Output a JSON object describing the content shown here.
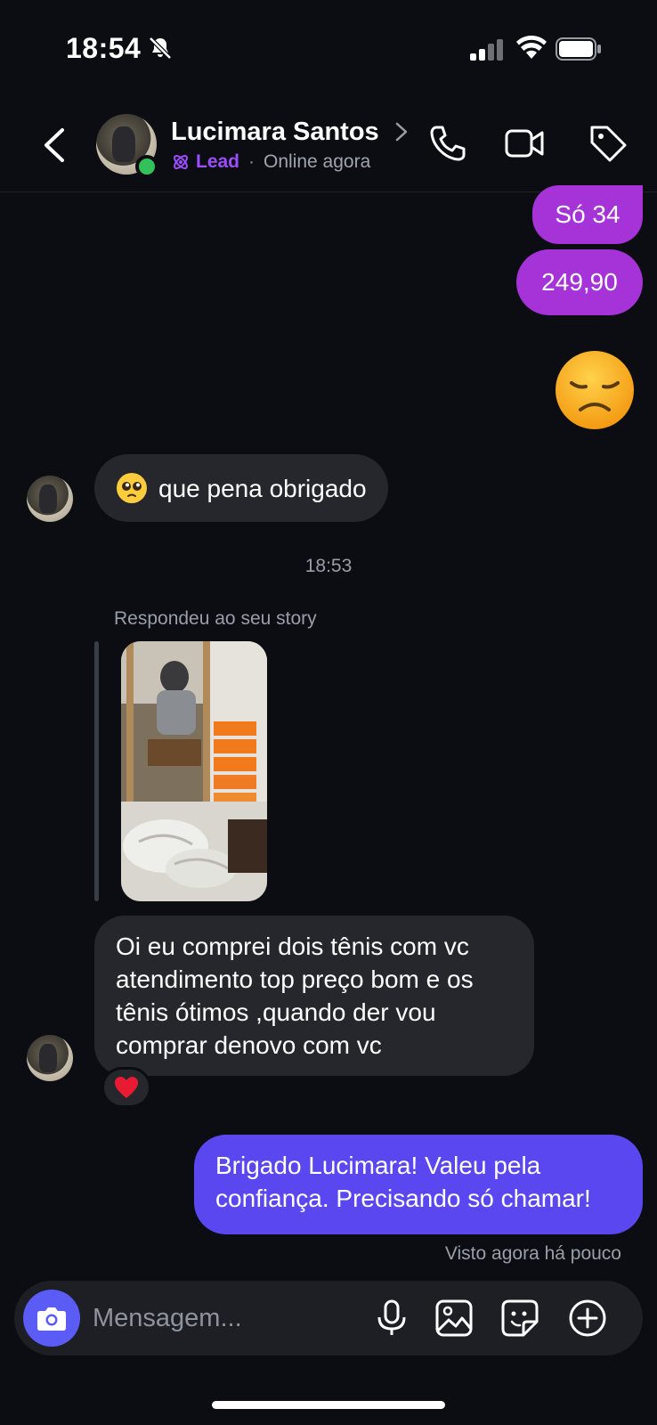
{
  "status_bar": {
    "time": "18:54"
  },
  "header": {
    "contact_name": "Lucimara Santos",
    "label": "Lead",
    "separator": "·",
    "presence": "Online agora"
  },
  "messages": {
    "m1": "Só 34",
    "m2": "249,90",
    "m3_emoji": "disappointed-face",
    "m4": "que pena obrigado",
    "timestamp": "18:53",
    "story_caption": "Respondeu ao seu story",
    "m5": "Oi eu comprei dois tênis com vc atendimento top preço bom e os tênis ótimos  ,quando der vou comprar denovo com vc",
    "m5_reaction": "heart",
    "m6": "Brigado Lucimara! Valeu pela confiança. Precisando só chamar!",
    "seen": "Visto agora há pouco"
  },
  "composer": {
    "placeholder": "Mensagem..."
  },
  "colors": {
    "background": "#0b0d12",
    "outgoing_purple": "#a533d8",
    "outgoing_violet": "#5a47f0",
    "incoming": "#25272d",
    "lead": "#9b4dff",
    "online": "#33c25a"
  }
}
